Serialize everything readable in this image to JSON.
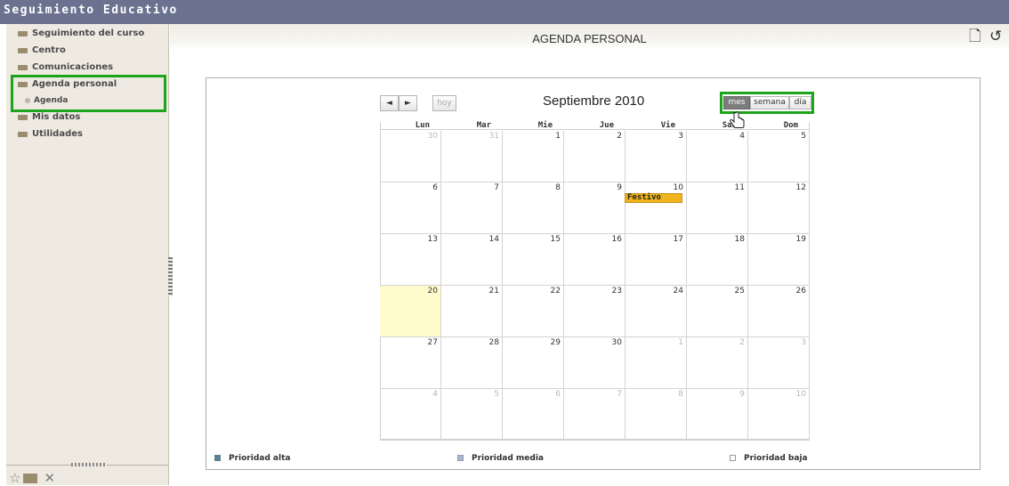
{
  "app": {
    "title": "Seguimiento Educativo"
  },
  "sidebar": {
    "items": [
      {
        "label": "Seguimiento del curso"
      },
      {
        "label": "Centro"
      },
      {
        "label": "Comunicaciones"
      },
      {
        "label": "Agenda personal"
      },
      {
        "label": "Agenda"
      },
      {
        "label": "Mis datos"
      },
      {
        "label": "Utilidades"
      }
    ],
    "bottom_icons": [
      "star-outline-icon",
      "folder-icon",
      "tools-icon"
    ]
  },
  "header": {
    "title": "AGENDA PERSONAL",
    "icons": [
      "new-document-icon",
      "refresh-icon"
    ]
  },
  "calendar": {
    "nav_prev": "◄",
    "nav_next": "►",
    "today_label": "hoy",
    "month_title": "Septiembre 2010",
    "views": {
      "month": "mes",
      "week": "semana",
      "day": "día",
      "active": "mes"
    },
    "weekdays": [
      "Lun",
      "Mar",
      "Mie",
      "Jue",
      "Vie",
      "Sab",
      "Dom"
    ],
    "weeks": [
      [
        30,
        31,
        1,
        2,
        3,
        4,
        5
      ],
      [
        6,
        7,
        8,
        9,
        10,
        11,
        12
      ],
      [
        13,
        14,
        15,
        16,
        17,
        18,
        19
      ],
      [
        20,
        21,
        22,
        23,
        24,
        25,
        26
      ],
      [
        27,
        28,
        29,
        30,
        1,
        2,
        3
      ],
      [
        4,
        5,
        6,
        7,
        8,
        9,
        10
      ]
    ],
    "events": [
      {
        "day": 10,
        "title": "Festivo",
        "color": "#f0b41c"
      }
    ],
    "today": 20
  },
  "legend": [
    {
      "label": "Prioridad alta",
      "color": "#5e7f94"
    },
    {
      "label": "Prioridad media",
      "color": "#a7b8c8"
    },
    {
      "label": "Prioridad baja",
      "color": "#ffffff"
    }
  ],
  "colors": {
    "accent_highlight": "#1ca51c",
    "topbar": "#6a7290",
    "today_cell": "#fffbcc"
  }
}
